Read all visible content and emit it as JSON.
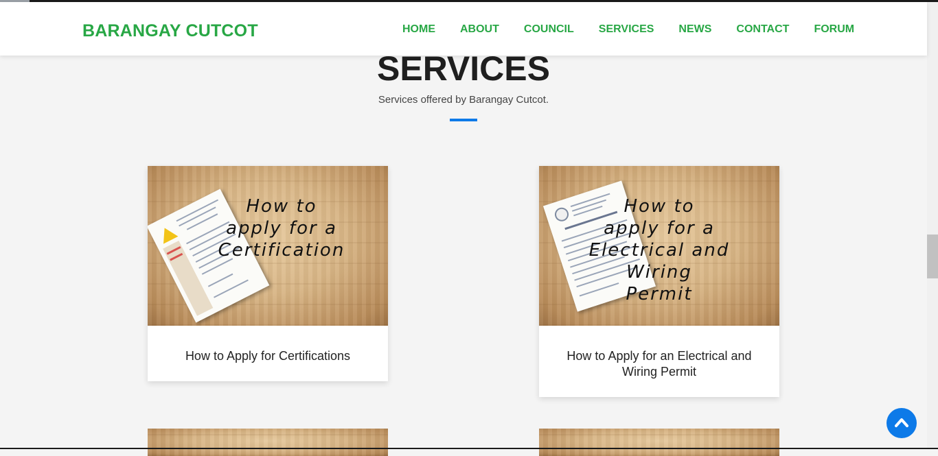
{
  "brand": "BARANGAY CUTCOT",
  "nav": [
    "HOME",
    "ABOUT",
    "COUNCIL",
    "SERVICES",
    "NEWS",
    "CONTACT",
    "FORUM"
  ],
  "section": {
    "title": "SERVICES",
    "subtitle": "Services offered by Barangay Cutcot."
  },
  "cards": [
    {
      "image_lines": [
        "How to",
        "apply for a",
        "Certification"
      ],
      "caption": "How to Apply for Certifications"
    },
    {
      "image_lines": [
        "How to",
        "apply for a",
        "Electrical and Wiring",
        "Permit"
      ],
      "caption": "How to Apply for an Electrical and Wiring Permit"
    }
  ],
  "colors": {
    "brand_green": "#28a745",
    "accent_blue": "#0d7ae8",
    "page_bg": "#f4f4f4"
  },
  "icons": {
    "back_to_top": "chevron-up-icon"
  }
}
